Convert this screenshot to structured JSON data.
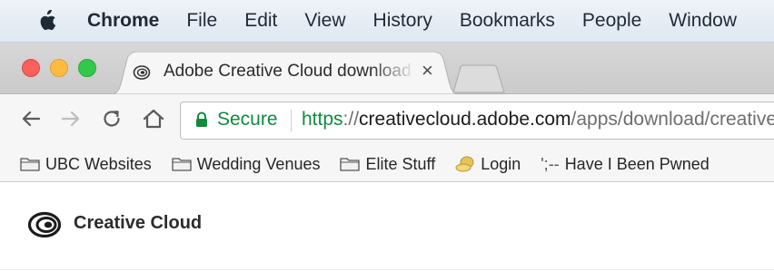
{
  "menubar": {
    "app_name": "Chrome",
    "items": [
      "File",
      "Edit",
      "View",
      "History",
      "Bookmarks",
      "People",
      "Window"
    ]
  },
  "tab": {
    "title": "Adobe Creative Cloud download",
    "close_glyph": "×"
  },
  "omnibox": {
    "secure_label": "Secure",
    "url_scheme": "https",
    "url_scheme_sep": "://",
    "url_host": "creativecloud.adobe.com",
    "url_path": "/apps/download/creative-cloud"
  },
  "bookmarks": {
    "items": [
      {
        "label": "UBC Websites",
        "icon": "folder-icon"
      },
      {
        "label": "Wedding Venues",
        "icon": "folder-icon"
      },
      {
        "label": "Elite Stuff",
        "icon": "folder-icon"
      },
      {
        "label": "Login",
        "icon": "login-favicon"
      },
      {
        "label": "Have I Been Pwned",
        "icon": "pwned-favicon",
        "prefix": "';--"
      }
    ]
  },
  "page": {
    "brand": "Creative Cloud"
  },
  "colors": {
    "secure_green": "#118a3e",
    "menubar_bg": "#e6ecf4",
    "tabstrip_bg": "#d1d1d1",
    "toolbar_bg": "#f6f6f6"
  }
}
